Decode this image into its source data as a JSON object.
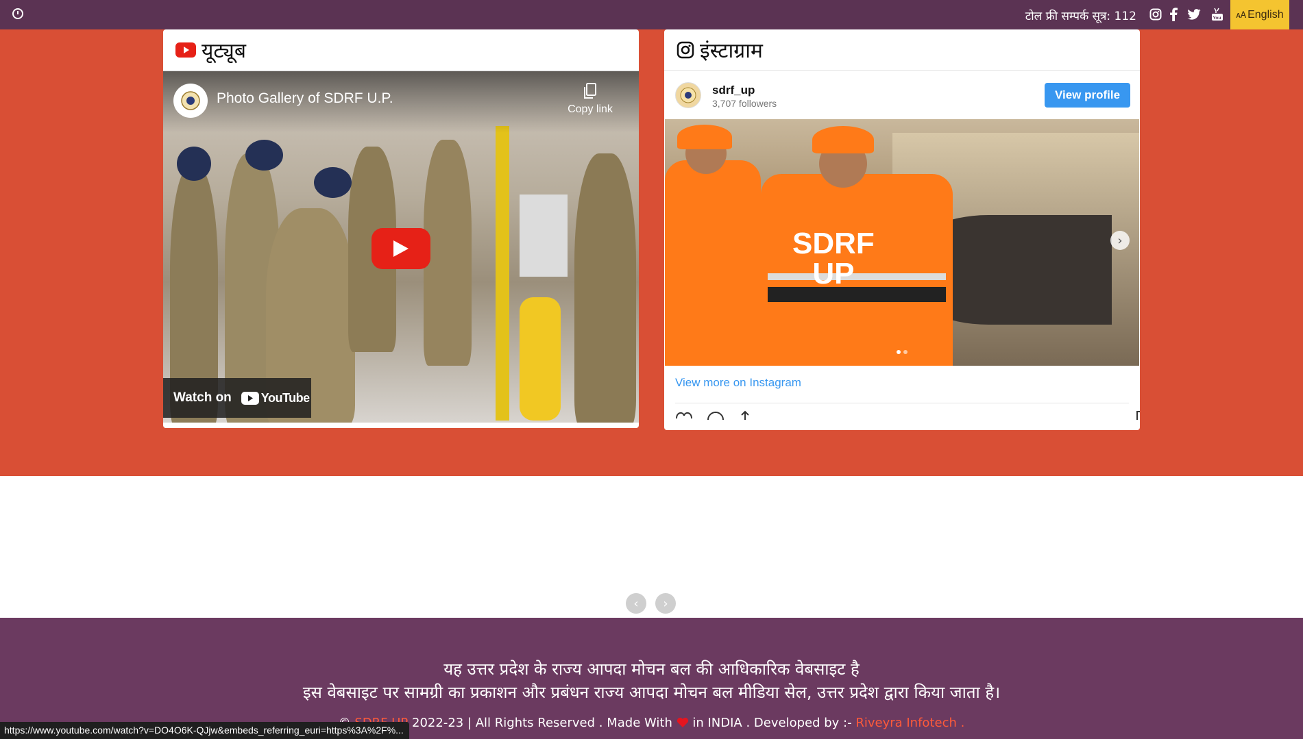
{
  "topbar": {
    "tollfree": "टोल फ्री सम्पर्क सूत्र: 112",
    "language": "English",
    "social_icons": [
      "instagram-icon",
      "facebook-icon",
      "twitter-icon",
      "youtube-icon"
    ]
  },
  "youtube_card": {
    "title": "यूट्यूब",
    "video_title": "Photo Gallery of SDRF U.P.",
    "copy_link": "Copy link",
    "watch_on": "Watch on",
    "youtube_brand": "YouTube"
  },
  "instagram_card": {
    "title": "इंस्टाग्राम",
    "username": "sdrf_up",
    "followers": "3,707 followers",
    "view_profile": "View profile",
    "photo_text_line1": "SDRF",
    "photo_text_line2": "UP",
    "view_more": "View more on Instagram"
  },
  "footer": {
    "line1": "यह उत्तर प्रदेश के राज्य आपदा मोचन बल की आधिकारिक वेबसाइट है",
    "line2": "इस वेबसाइट पर सामग्री का प्रकाशन और प्रबंधन राज्य आपदा मोचन बल मीडिया सेल, उत्तर प्रदेश द्वारा किया जाता है।",
    "copyright_prefix": "©",
    "copyright_brand": "SDRF UP",
    "copyright_rest": "2022-23 | All Rights Reserved . Made With",
    "copyright_after_heart": "in INDIA . Developed by :-",
    "developer": "Riveyra Infotech ."
  },
  "status_url": "https://www.youtube.com/watch?v=DO4O6K-QJjw&embeds_referring_euri=https%3A%2F%...",
  "colors": {
    "topbar": "#5b3353",
    "orange": "#d94f35",
    "footer": "#6b3a60",
    "language_button": "#f4c430",
    "instagram_blue": "#3897f0",
    "youtube_red": "#e62117"
  }
}
